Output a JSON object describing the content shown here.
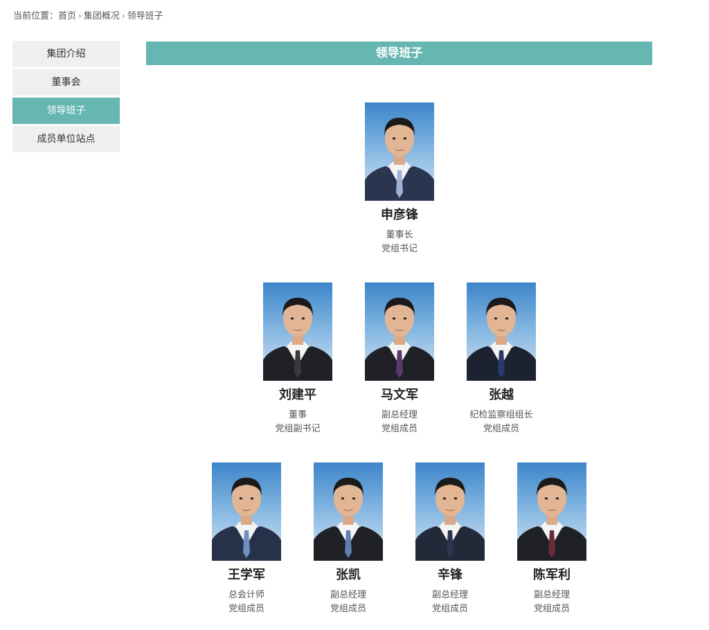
{
  "breadcrumb": {
    "label": "当前位置：",
    "items": [
      "首页",
      "集团概况",
      "领导班子"
    ],
    "separator": "›"
  },
  "sidebar": {
    "items": [
      {
        "label": "集团介绍",
        "active": false
      },
      {
        "label": "董事会",
        "active": false
      },
      {
        "label": "领导班子",
        "active": true
      },
      {
        "label": "成员单位站点",
        "active": false
      }
    ]
  },
  "section_title": "领导班子",
  "leaders": [
    {
      "name": "申彦锋",
      "roles": [
        "董事长",
        "党组书记"
      ],
      "tie": "#9fb3d8",
      "suit": "#2a3550"
    },
    {
      "name": "刘建平",
      "roles": [
        "董事",
        "党组副书记"
      ],
      "tie": "#3a3a3a",
      "suit": "#1f2126"
    },
    {
      "name": "马文军",
      "roles": [
        "副总经理",
        "党组成员"
      ],
      "tie": "#5a3a6e",
      "suit": "#1f2126"
    },
    {
      "name": "张越",
      "roles": [
        "纪检监察组组长",
        "党组成员"
      ],
      "tie": "#2a3a6a",
      "suit": "#1c2230"
    },
    {
      "name": "王学军",
      "roles": [
        "总会计师",
        "党组成员"
      ],
      "tie": "#6e8fc0",
      "suit": "#27324a"
    },
    {
      "name": "张凯",
      "roles": [
        "副总经理",
        "党组成员"
      ],
      "tie": "#5f7fb0",
      "suit": "#1f2126"
    },
    {
      "name": "辛锋",
      "roles": [
        "副总经理",
        "党组成员"
      ],
      "tie": "#2a3550",
      "suit": "#222a3a"
    },
    {
      "name": "陈军利",
      "roles": [
        "副总经理",
        "党组成员"
      ],
      "tie": "#6a2a3a",
      "suit": "#1f2126"
    }
  ],
  "colors": {
    "accent": "#66b6b2",
    "sidebar_bg": "#efefef"
  }
}
